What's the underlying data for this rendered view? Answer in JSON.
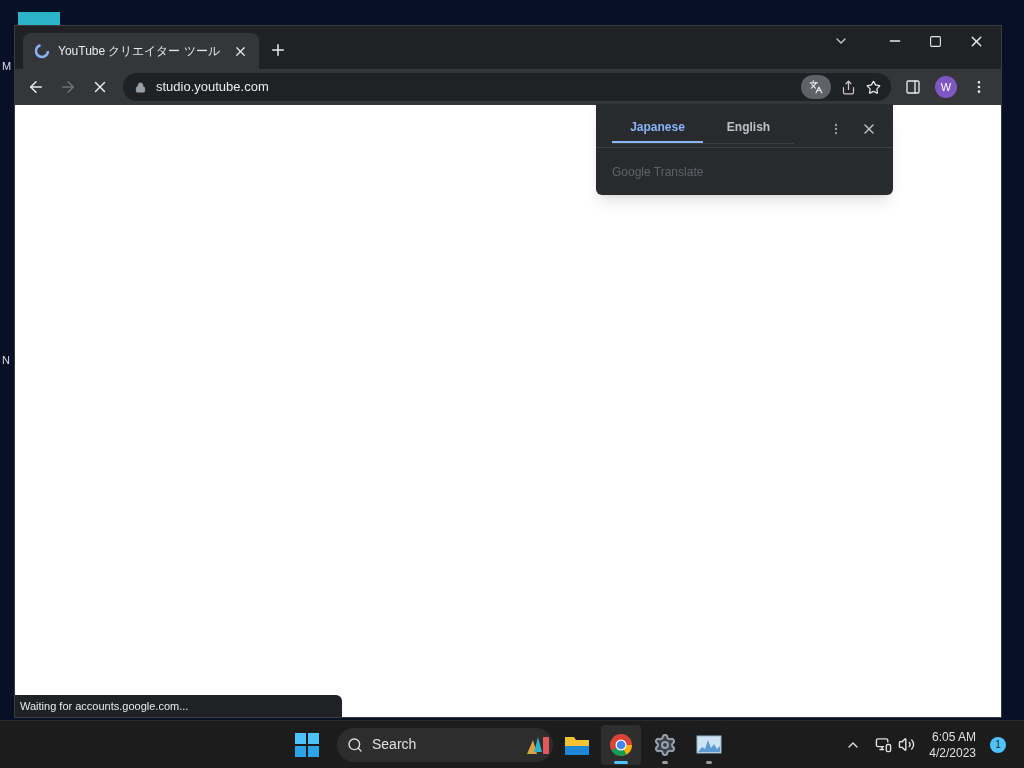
{
  "desktop": {
    "labels": [
      "M",
      "N"
    ]
  },
  "browser": {
    "tab": {
      "title": "YouTube クリエイター ツール",
      "loading": true
    },
    "toolbar": {
      "back_enabled": true,
      "forward_enabled": false,
      "address": "studio.youtube.com",
      "profile_initial": "W"
    },
    "translate_popup": {
      "languages": [
        {
          "label": "Japanese",
          "selected": true
        },
        {
          "label": "English",
          "selected": false
        }
      ],
      "footer": "Google Translate"
    },
    "status_bubble": "Waiting for accounts.google.com..."
  },
  "taskbar": {
    "search_placeholder": "Search",
    "apps": [
      {
        "kind": "files",
        "selected": false,
        "running": false
      },
      {
        "kind": "chrome",
        "selected": true,
        "running": true
      },
      {
        "kind": "settings",
        "selected": false,
        "running": true
      },
      {
        "kind": "monitor",
        "selected": false,
        "running": true
      }
    ],
    "time": "6:05 AM",
    "date": "4/2/2023",
    "notification_count": "1"
  }
}
